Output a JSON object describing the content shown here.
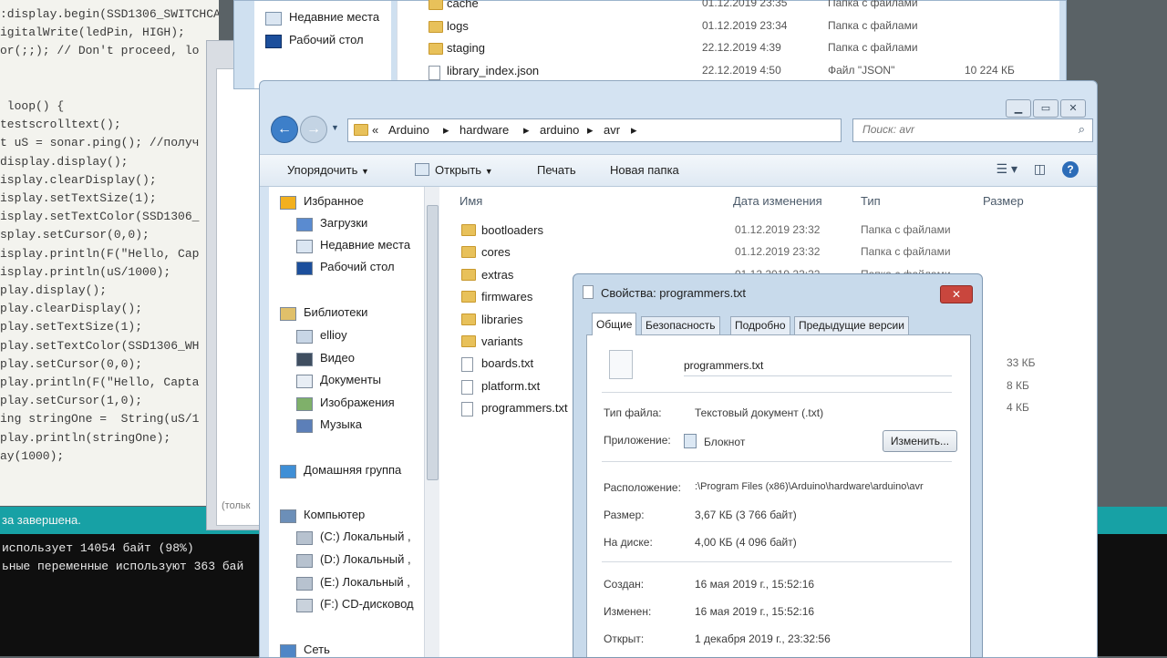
{
  "ide": {
    "code_lines": [
      {
        "text": ":display.begin(SSD1306_SWITCHCA"
      },
      {
        "text": "igitalWrite(ledPin, HIGH);"
      },
      {
        "text": "or(;;); // Don't proceed, lo"
      },
      {
        "text": ""
      },
      {
        "text": ""
      },
      {
        "text": " loop() {"
      },
      {
        "text": "testscrolltext();"
      },
      {
        "text": "t uS = sonar.ping(); //получ"
      },
      {
        "text": "display.display();"
      },
      {
        "text": "isplay.clearDisplay();"
      },
      {
        "text": "isplay.setTextSize(1);"
      },
      {
        "text": "isplay.setTextColor(SSD1306_"
      },
      {
        "text": "splay.setCursor(0,0);"
      },
      {
        "text": "isplay.println(F(\"Hello, Cap"
      },
      {
        "text": "isplay.println(uS/1000);"
      },
      {
        "text": "play.display();"
      },
      {
        "text": "play.clearDisplay();"
      },
      {
        "text": "play.setTextSize(1);"
      },
      {
        "text": "play.setTextColor(SSD1306_WH"
      },
      {
        "text": "play.setCursor(0,0);"
      },
      {
        "text": "play.println(F(\"Hello, Capta"
      },
      {
        "text": "play.setCursor(1,0);"
      },
      {
        "text": "ing stringOne =  String(uS/1"
      },
      {
        "text": "play.println(stringOne);"
      },
      {
        "text": "ay(1000);"
      }
    ],
    "status": "за завершена.",
    "console": [
      "использует 14054 байт (98%)",
      "ьные переменные используют 363 бай"
    ],
    "colors": {
      "status_bar": "#17a1a5",
      "console_bg": "#0f0f0f"
    }
  },
  "middle_window": {
    "partial_text": "(тольк"
  },
  "back_explorer": {
    "nav": [
      "Недавние места",
      "Рабочий стол"
    ],
    "rows": [
      {
        "name": "cache",
        "date": "01.12.2019 23:35",
        "type": "Папка с файлами",
        "size": ""
      },
      {
        "name": "logs",
        "date": "01.12.2019 23:34",
        "type": "Папка с файлами",
        "size": ""
      },
      {
        "name": "staging",
        "date": "22.12.2019 4:39",
        "type": "Папка с файлами",
        "size": ""
      },
      {
        "name": "library_index.json",
        "date": "22.12.2019 4:50",
        "type": "Файл \"JSON\"",
        "size": "10 224 КБ"
      }
    ]
  },
  "explorer": {
    "breadcrumb": [
      "«",
      "Arduino",
      "hardware",
      "arduino",
      "avr"
    ],
    "search_placeholder": "Поиск: avr",
    "toolbar": {
      "organize": "Упорядочить",
      "open": "Открыть",
      "print": "Печать",
      "new_folder": "Новая папка"
    },
    "columns": {
      "name": "Имя",
      "date": "Дата изменения",
      "type": "Тип",
      "size": "Размер"
    },
    "nav": [
      {
        "label": "Избранное",
        "icon": "star-icon"
      },
      {
        "label": "Загрузки",
        "icon": "downloads-icon"
      },
      {
        "label": "Недавние места",
        "icon": "recent-places-icon"
      },
      {
        "label": "Рабочий стол",
        "icon": "desktop-icon"
      },
      {
        "label": "Библиотеки",
        "icon": "libraries-icon"
      },
      {
        "label": "ellioy",
        "icon": "library-folder-icon"
      },
      {
        "label": "Видео",
        "icon": "video-icon"
      },
      {
        "label": "Документы",
        "icon": "documents-icon"
      },
      {
        "label": "Изображения",
        "icon": "pictures-icon"
      },
      {
        "label": "Музыка",
        "icon": "music-icon"
      },
      {
        "label": "Домашняя группа",
        "icon": "homegroup-icon"
      },
      {
        "label": "Компьютер",
        "icon": "computer-icon"
      },
      {
        "label": "(C:) Локальный ,",
        "icon": "drive-icon"
      },
      {
        "label": "(D:) Локальный ,",
        "icon": "drive-icon"
      },
      {
        "label": "(E:) Локальный ,",
        "icon": "drive-icon"
      },
      {
        "label": "(F:) CD-дисковод",
        "icon": "cd-drive-icon"
      },
      {
        "label": "Сеть",
        "icon": "network-icon"
      }
    ],
    "files": [
      {
        "name": "bootloaders",
        "date": "01.12.2019 23:32",
        "type": "Папка с файлами",
        "size": "",
        "kind": "folder"
      },
      {
        "name": "cores",
        "date": "01.12.2019 23:32",
        "type": "Папка с файлами",
        "size": "",
        "kind": "folder"
      },
      {
        "name": "extras",
        "date": "01.12.2019 23:32",
        "type": "Папка с файлами",
        "size": "",
        "kind": "folder"
      },
      {
        "name": "firmwares",
        "date": "",
        "type": "",
        "size": "",
        "kind": "folder"
      },
      {
        "name": "libraries",
        "date": "",
        "type": "",
        "size": "",
        "kind": "folder"
      },
      {
        "name": "variants",
        "date": "",
        "type": "",
        "size": "",
        "kind": "folder"
      },
      {
        "name": "boards.txt",
        "date": "",
        "type": "",
        "size": "33 КБ",
        "kind": "file"
      },
      {
        "name": "platform.txt",
        "date": "",
        "type": "",
        "size": "8 КБ",
        "kind": "file"
      },
      {
        "name": "programmers.txt",
        "date": "",
        "type": "",
        "size": "4 КБ",
        "kind": "file"
      }
    ]
  },
  "properties": {
    "title": "Свойства: programmers.txt",
    "close": "✕",
    "tabs": [
      "Общие",
      "Безопасность",
      "Подробно",
      "Предыдущие версии"
    ],
    "filename": "programmers.txt",
    "rows": {
      "type_label": "Тип файла:",
      "type_value": "Текстовый документ (.txt)",
      "app_label": "Приложение:",
      "app_value": "Блокнот",
      "change_button": "Изменить...",
      "location_label": "Расположение:",
      "location_value": ":\\Program Files (x86)\\Arduino\\hardware\\arduino\\avr",
      "size_label": "Размер:",
      "size_value": "3,67 КБ (3 766 байт)",
      "disk_label": "На диске:",
      "disk_value": "4,00 КБ (4 096 байт)",
      "created_label": "Создан:",
      "created_value": "16 мая 2019 г., 15:52:16",
      "modified_label": "Изменен:",
      "modified_value": "16 мая 2019 г., 15:52:16",
      "opened_label": "Открыт:",
      "opened_value": "1 декабря 2019 г., 23:32:56"
    }
  }
}
